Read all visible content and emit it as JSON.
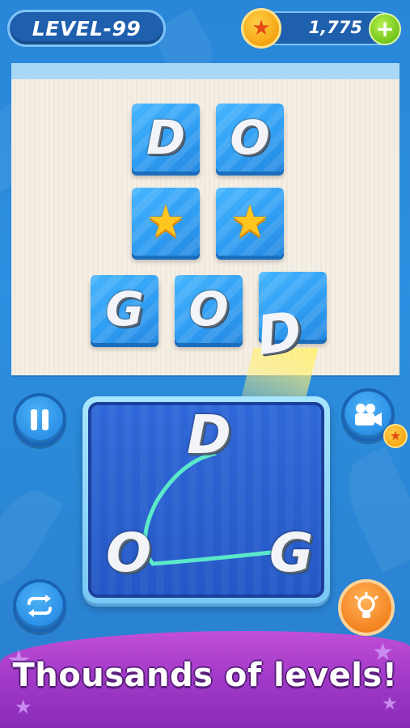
{
  "header": {
    "level_label": "LEVEL-99",
    "coins": "1,775",
    "coin_icon": "star-coin-icon",
    "add_coins_symbol": "+"
  },
  "board": {
    "rows": [
      [
        "D",
        "O"
      ],
      [
        "★",
        "★"
      ],
      [
        "G",
        "O",
        "D"
      ]
    ],
    "flying_letter": "D"
  },
  "wheel": {
    "letters": {
      "top": "D",
      "left": "O",
      "right": "G"
    }
  },
  "controls": {
    "pause": "pause-icon",
    "shuffle": "shuffle-icon",
    "video": "video-camera-icon",
    "hint": "lightbulb-icon"
  },
  "banner": {
    "text": "Thousands of levels!"
  },
  "colors": {
    "background": "#2c8fe0",
    "tile": "#2e9cf2",
    "banner": "#a43bc9",
    "trace_line": "#5ef0c8",
    "coin": "#f5a411"
  }
}
